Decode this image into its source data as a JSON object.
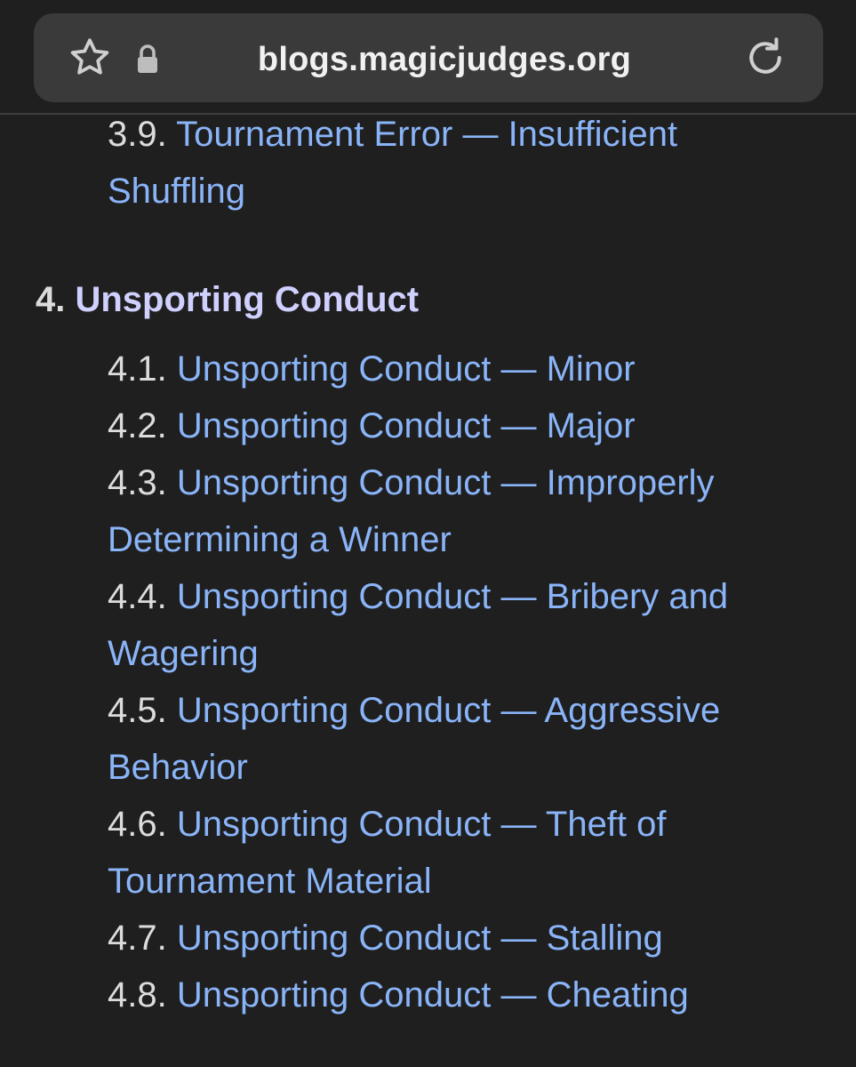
{
  "browser": {
    "url": "blogs.magicjudges.org",
    "icons": [
      "star-icon",
      "lock-icon",
      "reload-icon"
    ]
  },
  "colors": {
    "background": "#1f1f1f",
    "link": "#8ab4f8",
    "heading_link": "#d0d0ff",
    "text": "#dcdcdc"
  },
  "toc": {
    "prev_item": {
      "number": "3.9. ",
      "title": "Tournament Error — Insufficient Shuffling"
    },
    "section": {
      "number": "4. ",
      "title": "Unsporting Conduct"
    },
    "items": [
      {
        "number": "4.1. ",
        "title": "Unsporting Conduct — Minor"
      },
      {
        "number": "4.2. ",
        "title": "Unsporting Conduct — Major"
      },
      {
        "number": "4.3. ",
        "title": "Unsporting Conduct — Improperly Determining a Winner"
      },
      {
        "number": "4.4. ",
        "title": "Unsporting Conduct — Bribery and Wagering"
      },
      {
        "number": "4.5. ",
        "title": "Unsporting Conduct — Aggressive Behavior"
      },
      {
        "number": "4.6. ",
        "title": "Unsporting Conduct — Theft of Tournament Material"
      },
      {
        "number": "4.7. ",
        "title": "Unsporting Conduct — Stalling"
      },
      {
        "number": "4.8. ",
        "title": "Unsporting Conduct — Cheating"
      }
    ]
  }
}
